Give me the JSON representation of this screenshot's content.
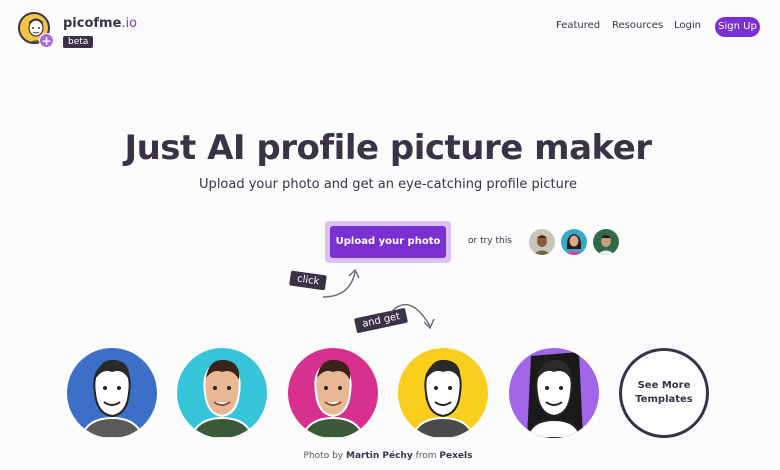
{
  "header": {
    "brand_name": "picofme",
    "brand_tld": ".io",
    "beta": "beta",
    "nav": [
      "Featured",
      "Resources",
      "Login"
    ],
    "signup": "Sign Up"
  },
  "hero": {
    "title": "Just AI profile picture maker",
    "subtitle": "Upload your photo and get an eye-catching profile picture",
    "upload_button": "Upload your photo",
    "or_try": "or try this",
    "click_tag": "click",
    "and_get_tag": "and get"
  },
  "templates": {
    "see_more": "See More Templates",
    "colors": [
      "#3c6fc7",
      "#35c4d8",
      "#d8308f",
      "#f7cf1c",
      "#a065e8"
    ]
  },
  "credit": {
    "prefix": "Photo by",
    "author": "Martin Péchy",
    "middle": "from",
    "source": "Pexels"
  },
  "colors": {
    "accent": "#7a2fd0",
    "text": "#3a3247"
  }
}
